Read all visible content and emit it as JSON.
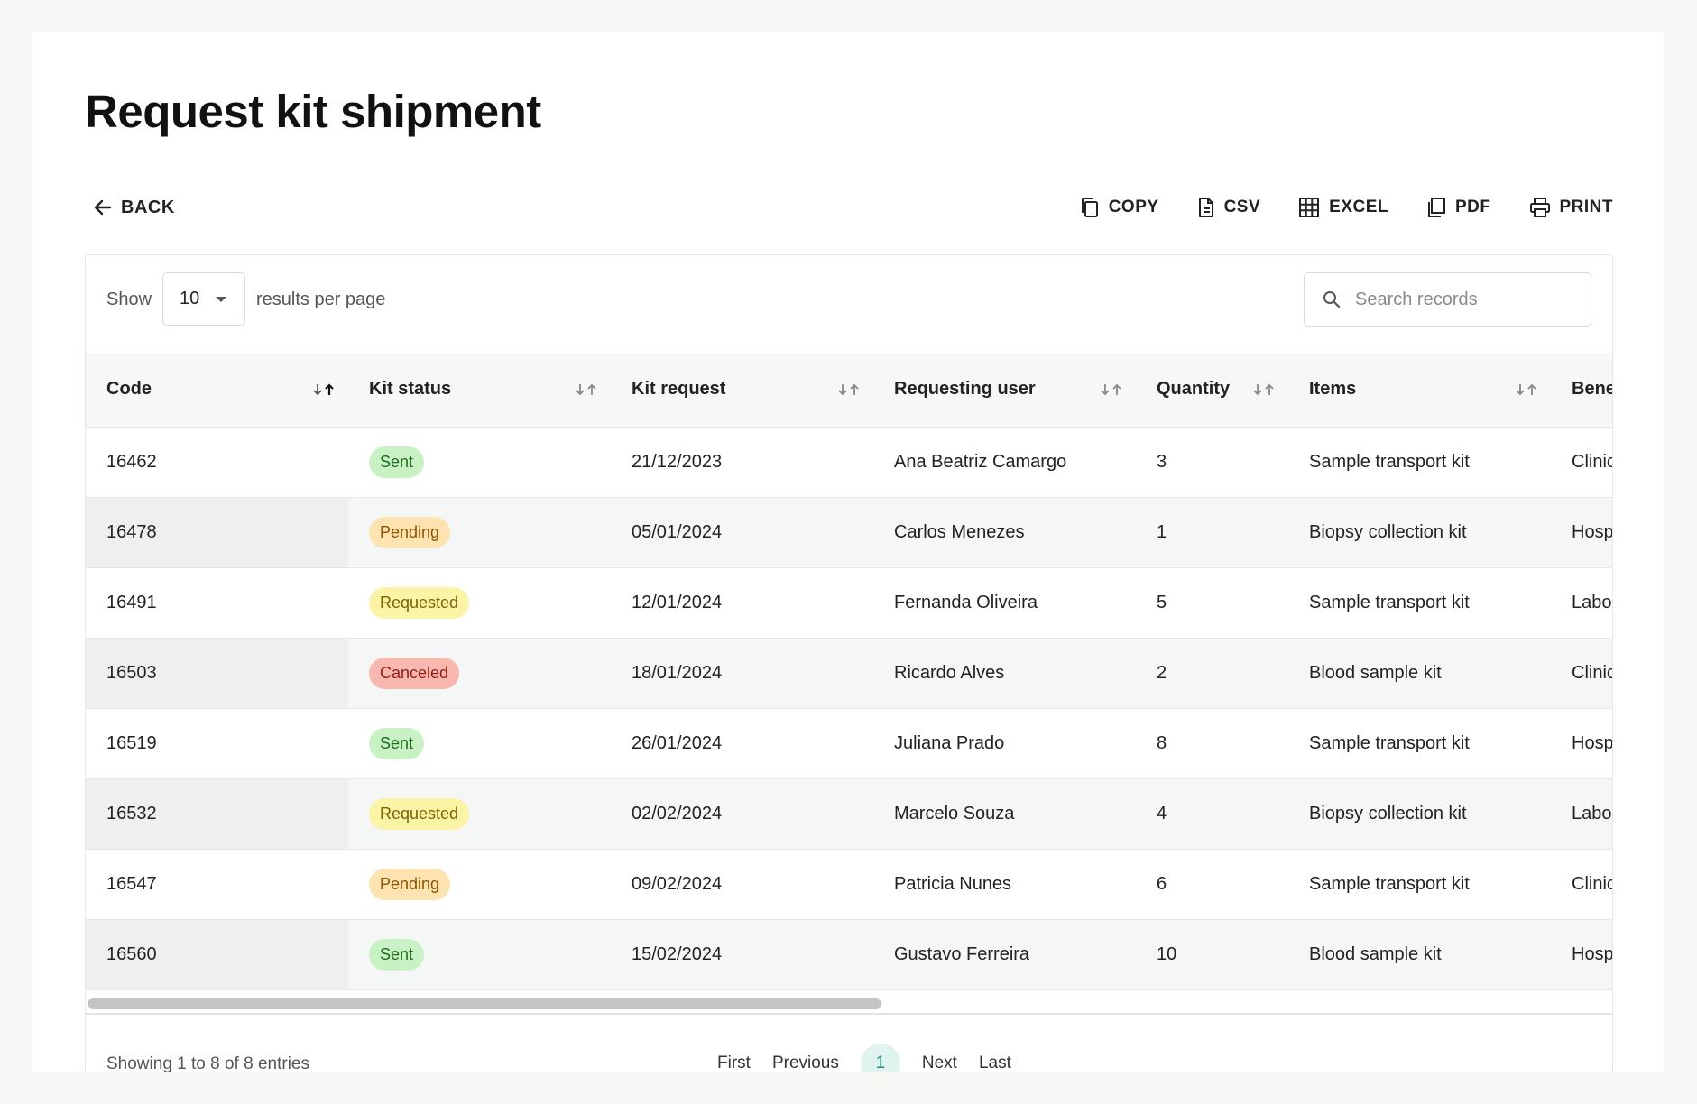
{
  "page": {
    "title": "Request kit shipment"
  },
  "toolbar": {
    "back_label": "BACK",
    "exports": [
      {
        "label": "COPY",
        "icon": "copy-icon"
      },
      {
        "label": "CSV",
        "icon": "file-icon"
      },
      {
        "label": "EXCEL",
        "icon": "grid-icon"
      },
      {
        "label": "PDF",
        "icon": "document-icon"
      },
      {
        "label": "PRINT",
        "icon": "printer-icon"
      }
    ]
  },
  "controls": {
    "show_label": "Show",
    "page_size": "10",
    "per_page_label": "results per page",
    "search_placeholder": "Search records",
    "search_value": ""
  },
  "table": {
    "columns": [
      "Code",
      "Kit status",
      "Kit request",
      "Requesting user",
      "Quantity",
      "Items",
      "Bene"
    ],
    "rows": [
      {
        "code": "16462",
        "status": "Sent",
        "date": "21/12/2023",
        "user": "Ana Beatriz Camargo",
        "qty": "3",
        "items": "Sample transport kit",
        "bene": "Clinic"
      },
      {
        "code": "16478",
        "status": "Pending",
        "date": "05/01/2024",
        "user": "Carlos Menezes",
        "qty": "1",
        "items": "Biopsy collection kit",
        "bene": "Hosp"
      },
      {
        "code": "16491",
        "status": "Requested",
        "date": "12/01/2024",
        "user": "Fernanda Oliveira",
        "qty": "5",
        "items": "Sample transport kit",
        "bene": "Labo"
      },
      {
        "code": "16503",
        "status": "Canceled",
        "date": "18/01/2024",
        "user": "Ricardo Alves",
        "qty": "2",
        "items": "Blood sample kit",
        "bene": "Clinic"
      },
      {
        "code": "16519",
        "status": "Sent",
        "date": "26/01/2024",
        "user": "Juliana Prado",
        "qty": "8",
        "items": "Sample transport kit",
        "bene": "Hosp"
      },
      {
        "code": "16532",
        "status": "Requested",
        "date": "02/02/2024",
        "user": "Marcelo Souza",
        "qty": "4",
        "items": "Biopsy collection kit",
        "bene": "Labo"
      },
      {
        "code": "16547",
        "status": "Pending",
        "date": "09/02/2024",
        "user": "Patricia Nunes",
        "qty": "6",
        "items": "Sample transport kit",
        "bene": "Clinic"
      },
      {
        "code": "16560",
        "status": "Sent",
        "date": "15/02/2024",
        "user": "Gustavo Ferreira",
        "qty": "10",
        "items": "Blood sample kit",
        "bene": "Hosp"
      }
    ],
    "status_colors": {
      "Sent": {
        "bg": "#c9f2c4",
        "fg": "#1f6b1f"
      },
      "Pending": {
        "bg": "#fde3b0",
        "fg": "#8a5400"
      },
      "Requested": {
        "bg": "#fbf3a6",
        "fg": "#7a6400"
      },
      "Canceled": {
        "bg": "#f8b8b0",
        "fg": "#8f1d12"
      }
    }
  },
  "footer": {
    "entries_info": "Showing 1 to 8 of 8 entries",
    "first_label": "First",
    "previous_label": "Previous",
    "current_page": "1",
    "next_label": "Next",
    "last_label": "Last"
  }
}
